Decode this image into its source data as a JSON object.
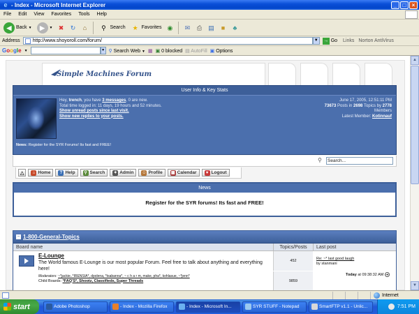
{
  "window": {
    "title": "- Index - Microsoft Internet Explorer"
  },
  "menu": [
    "File",
    "Edit",
    "View",
    "Favorites",
    "Tools",
    "Help"
  ],
  "toolbar": {
    "back": "Back",
    "search": "Search",
    "favorites": "Favorites"
  },
  "address": {
    "label": "Address",
    "url": "http://www.shoyoroll.com/forum/",
    "go": "Go",
    "links": "Links",
    "antivirus": "Norton AntiVirus"
  },
  "google": {
    "logo": "Google",
    "search_web": "Search Web",
    "blocked": "0 blocked",
    "autofill": "AutoFill",
    "options": "Options"
  },
  "forum": {
    "logo": "Simple Machines Forum",
    "userinfo": {
      "heading": "User Info & Key Stats",
      "greeting_pre": "Hey, ",
      "username": "trench",
      "greeting_mid": ", you have ",
      "messages": "3 messages",
      "greeting_post": ", 0 are new.",
      "time_logged": "Total time logged in: 11 days, 19 hours and 52 minutes.",
      "unread_link": "Show unread posts since last visit.",
      "replies_link": "Show new replies to your posts."
    },
    "stats": {
      "date": "June 17, 2005, 12:51:11 PM",
      "posts_count": "73673",
      "posts_mid": " Posts in ",
      "topics_count": "2698",
      "topics_mid": " Topics by ",
      "members_count": "2778",
      "members_label": "Members",
      "latest_label": "Latest Member: ",
      "latest_member": "Kotinnauf"
    },
    "news_line_label": "News:",
    "news_line": "Register for the SYR Forums! Its fast and FREE!",
    "search_placeholder": "Search...",
    "nav": [
      "Home",
      "Help",
      "Search",
      "Admin",
      "Profile",
      "Calendar",
      "Logout"
    ],
    "news": {
      "heading": "News",
      "body": "Register for the SYR forums! Its fast and FREE!"
    },
    "category": {
      "name": "1-800-General-Topics",
      "col_board": "Board name",
      "col_topics": "Topics/Posts",
      "col_last": "Last post",
      "board": {
        "title": "E-Lounge",
        "desc": "The World famous E-Lounge is our most popular Forum. Feel free to talk about anything and everything here!",
        "mods_label": "Moderators:",
        "mods": "~*jackie..*IRENSIA*, dpolena, *tsabanna*, ~ c h a r m, make, pha*, kohlasue, ~*jenn*",
        "child_label": "Child Boards:",
        "child": "*FAQ'S*, Shootz, Classifieds, Super Threads",
        "topics": "452",
        "posts": "9859",
        "last_post_title": "Re: ~* last good laugh",
        "last_post_by": "by stanmani",
        "last_post_when": "Today",
        "last_post_time": " at 09:38:32 AM"
      }
    }
  },
  "statusbar": {
    "zone": "Internet"
  },
  "taskbar": {
    "start": "start",
    "tasks": [
      "Adobe Photoshop",
      "- Index - Mozilla Firefox",
      "- Index - Microsoft In...",
      "SYR STUFF - Notepad",
      "SmartFTP v1.1 - Unlic..."
    ],
    "clock": "7:51 PM"
  },
  "colors": {
    "forum_blue": "#4b6fad",
    "xp_blue": "#0a4fd8",
    "start_green": "#47a847"
  }
}
